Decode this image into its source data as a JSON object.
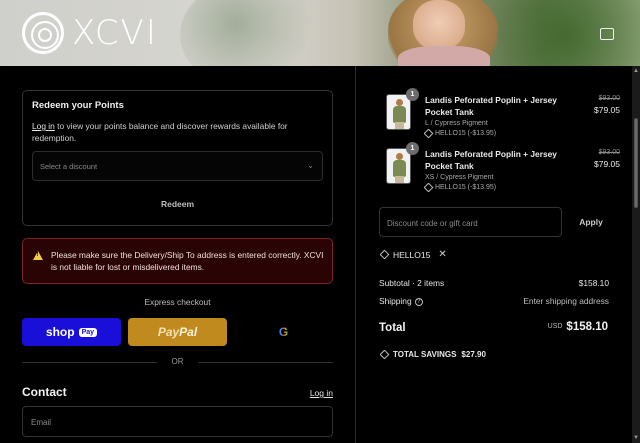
{
  "brand": {
    "name": "XCVI"
  },
  "points": {
    "title": "Redeem your Points",
    "login_link": "Log in",
    "description": "to view your points balance and discover rewards available for redemption.",
    "select_placeholder": "Select a discount",
    "redeem_label": "Redeem"
  },
  "warning": {
    "text": "Please make sure the Delivery/Ship To address is entered correctly. XCVI is not liable for lost or misdelivered items."
  },
  "express": {
    "label": "Express checkout",
    "shop_label": "shop",
    "shop_pay_badge": "Pay",
    "paypal_label_a": "Pay",
    "paypal_label_b": "Pal",
    "google_label": "G",
    "or_label": "OR"
  },
  "contact": {
    "title": "Contact",
    "login_link": "Log in",
    "email_placeholder": "Email"
  },
  "order": {
    "items": [
      {
        "qty": "1",
        "name": "Landis Peforated Poplin + Jersey Pocket Tank",
        "variant": "L / Cypress Pigment",
        "discount": "HELLO15 (-$13.95)",
        "old_price": "$93.00",
        "price": "$79.05"
      },
      {
        "qty": "1",
        "name": "Landis Peforated Poplin + Jersey Pocket Tank",
        "variant": "XS / Cypress Pigment",
        "discount": "HELLO15 (-$13.95)",
        "old_price": "$93.00",
        "price": "$79.05"
      }
    ],
    "code_placeholder": "Discount code or gift card",
    "apply_label": "Apply",
    "applied_code": "HELLO15",
    "subtotal_label": "Subtotal · 2 items",
    "subtotal_value": "$158.10",
    "shipping_label": "Shipping",
    "shipping_value": "Enter shipping address",
    "total_label": "Total",
    "total_currency": "USD",
    "total_value": "$158.10",
    "savings_label": "TOTAL SAVINGS",
    "savings_value": "$27.90"
  },
  "colors": {
    "shop_pay": "#1a0fd8",
    "paypal": "#c08a1e",
    "warning_bg": "#2a0404",
    "warning_border": "#7a2424"
  },
  "icons": {
    "warning": "warning-triangle-icon",
    "tag": "tag-icon",
    "info": "info-icon",
    "close": "close-icon",
    "chevron": "chevron-down-icon"
  }
}
